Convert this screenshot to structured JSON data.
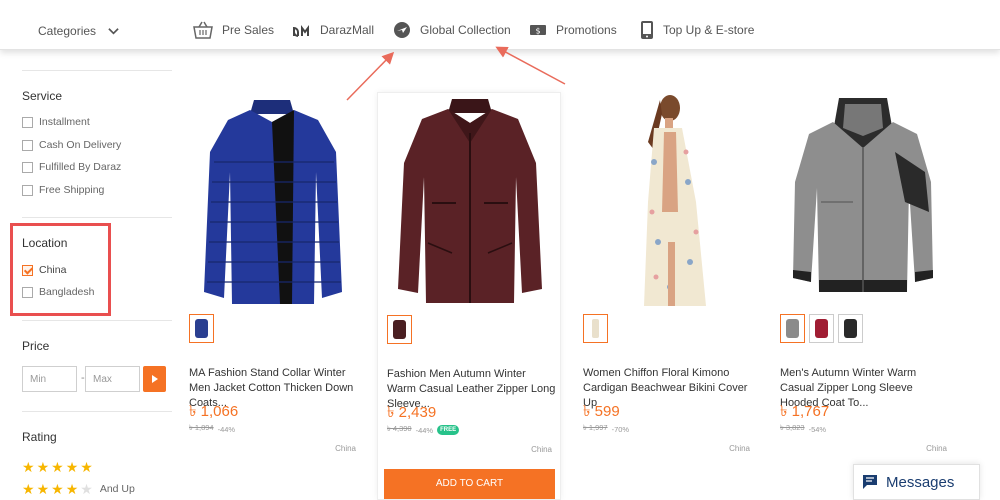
{
  "nav": {
    "categories_label": "Categories",
    "items": [
      {
        "label": "Pre Sales",
        "icon": "basket-icon"
      },
      {
        "label": "DarazMall",
        "icon": "darazmall-logo-icon"
      },
      {
        "label": "Global Collection",
        "icon": "globe-plane-icon"
      },
      {
        "label": "Promotions",
        "icon": "voucher-icon"
      },
      {
        "label": "Top Up & E-store",
        "icon": "phone-icon"
      }
    ]
  },
  "sidebar": {
    "service": {
      "title": "Service",
      "options": [
        "Installment",
        "Cash On Delivery",
        "Fulfilled By Daraz",
        "Free Shipping"
      ]
    },
    "location": {
      "title": "Location",
      "options": [
        {
          "label": "China",
          "checked": true
        },
        {
          "label": "Bangladesh",
          "checked": false
        }
      ]
    },
    "price": {
      "title": "Price",
      "min_placeholder": "Min",
      "separator": "-",
      "max_placeholder": "Max"
    },
    "rating": {
      "title": "Rating",
      "rows": [
        {
          "stars": 5,
          "suffix": ""
        },
        {
          "stars": 4,
          "suffix": "And Up"
        }
      ]
    }
  },
  "products": [
    {
      "title": "MA Fashion Stand Collar Winter Men Jacket Cotton Thicken Down Coats...",
      "price": "৳ 1,066",
      "original_price": "৳ 1,894",
      "discount": "-44%",
      "free_shipping": false,
      "origin": "China",
      "thumbs": [
        "#2a3f91"
      ]
    },
    {
      "title": "Fashion Men Autumn Winter Warm Casual Leather Zipper Long Sleeve...",
      "price": "৳ 2,439",
      "original_price": "৳ 4,390",
      "discount": "-44%",
      "free_shipping": true,
      "free_label": "FREE",
      "origin": "China",
      "add_to_cart": "ADD TO CART",
      "thumbs": [
        "#4a1f22"
      ]
    },
    {
      "title": "Women Chiffon Floral Kimono Cardigan Beachwear Bikini Cover Up",
      "price": "৳ 599",
      "original_price": "৳ 1,997",
      "discount": "-70%",
      "free_shipping": false,
      "origin": "China",
      "thumbs": [
        "#e9e0cc"
      ]
    },
    {
      "title": "Men's Autumn Winter Warm Casual Zipper Long Sleeve Hooded Coat To...",
      "price": "৳ 1,767",
      "original_price": "৳ 3,823",
      "discount": "-54%",
      "free_shipping": false,
      "origin": "China",
      "thumbs": [
        "#8b8b8b",
        "#a01d33",
        "#2a2a2a"
      ]
    }
  ],
  "messages": {
    "label": "Messages"
  },
  "colors": {
    "accent": "#f57224",
    "highlight": "#e94f4f",
    "star": "#f7b600"
  }
}
